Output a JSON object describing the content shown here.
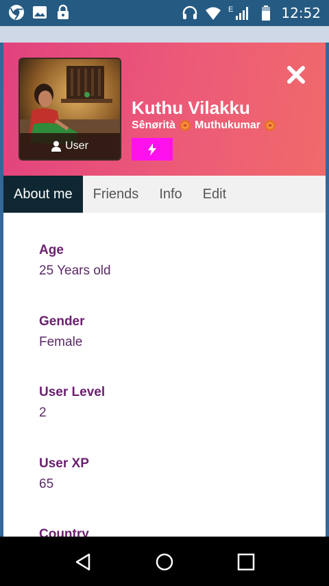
{
  "status_bar": {
    "time": "12:52",
    "network_type": "E",
    "left_icons": [
      "chrome-icon",
      "image-icon",
      "lock-icon"
    ],
    "right_icons": [
      "headset-icon",
      "wifi-icon",
      "signal-icon",
      "battery-icon"
    ]
  },
  "profile": {
    "name": "Kuthu Vilakku",
    "subtitle_parts": [
      "Sênørità",
      "Muthukumar"
    ],
    "avatar_badge": "User",
    "accent_color": "#ff11ee"
  },
  "tabs": [
    {
      "label": "About me",
      "active": true
    },
    {
      "label": "Friends",
      "active": false
    },
    {
      "label": "Info",
      "active": false
    },
    {
      "label": "Edit",
      "active": false
    }
  ],
  "fields": [
    {
      "label": "Age",
      "value": "25 Years old"
    },
    {
      "label": "Gender",
      "value": "Female"
    },
    {
      "label": "User Level",
      "value": "2"
    },
    {
      "label": "User XP",
      "value": "65"
    },
    {
      "label": "Country",
      "value": ""
    }
  ],
  "navbar": {
    "buttons": [
      "back-icon",
      "home-icon",
      "recents-icon"
    ]
  }
}
